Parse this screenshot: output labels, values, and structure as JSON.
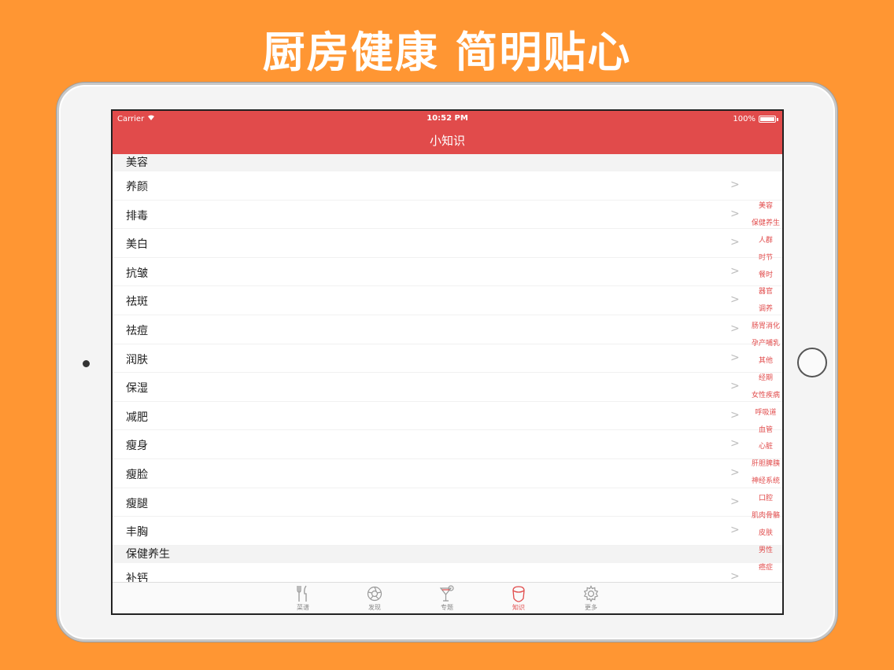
{
  "headline": "厨房健康 简明贴心",
  "status_bar": {
    "carrier": "Carrier",
    "time": "10:52 PM",
    "battery": "100%"
  },
  "nav": {
    "title": "小知识"
  },
  "sections": [
    {
      "title": "美容",
      "rows": [
        "养颜",
        "排毒",
        "美白",
        "抗皱",
        "祛斑",
        "祛痘",
        "润肤",
        "保湿",
        "减肥",
        "瘦身",
        "瘦脸",
        "瘦腿",
        "丰胸"
      ]
    },
    {
      "title": "保健养生",
      "rows": [
        "补钙"
      ]
    }
  ],
  "index": [
    "美容",
    "保健养生",
    "人群",
    "时节",
    "餐时",
    "器官",
    "调养",
    "肠胃消化",
    "孕产哺乳",
    "其他",
    "经期",
    "女性疾病",
    "呼吸道",
    "血管",
    "心脏",
    "肝胆脾胰",
    "神经系统",
    "口腔",
    "肌肉骨骼",
    "皮肤",
    "男性",
    "癌症"
  ],
  "tabs": [
    {
      "label": "菜谱",
      "icon": "fork-knife-icon",
      "active": false
    },
    {
      "label": "发现",
      "icon": "aperture-icon",
      "active": false
    },
    {
      "label": "专题",
      "icon": "cocktail-icon",
      "active": false
    },
    {
      "label": "知识",
      "icon": "chef-icon",
      "active": true
    },
    {
      "label": "更多",
      "icon": "gear-icon",
      "active": false
    }
  ],
  "colors": {
    "accent": "#E14B4B",
    "background": "#FF9633"
  }
}
